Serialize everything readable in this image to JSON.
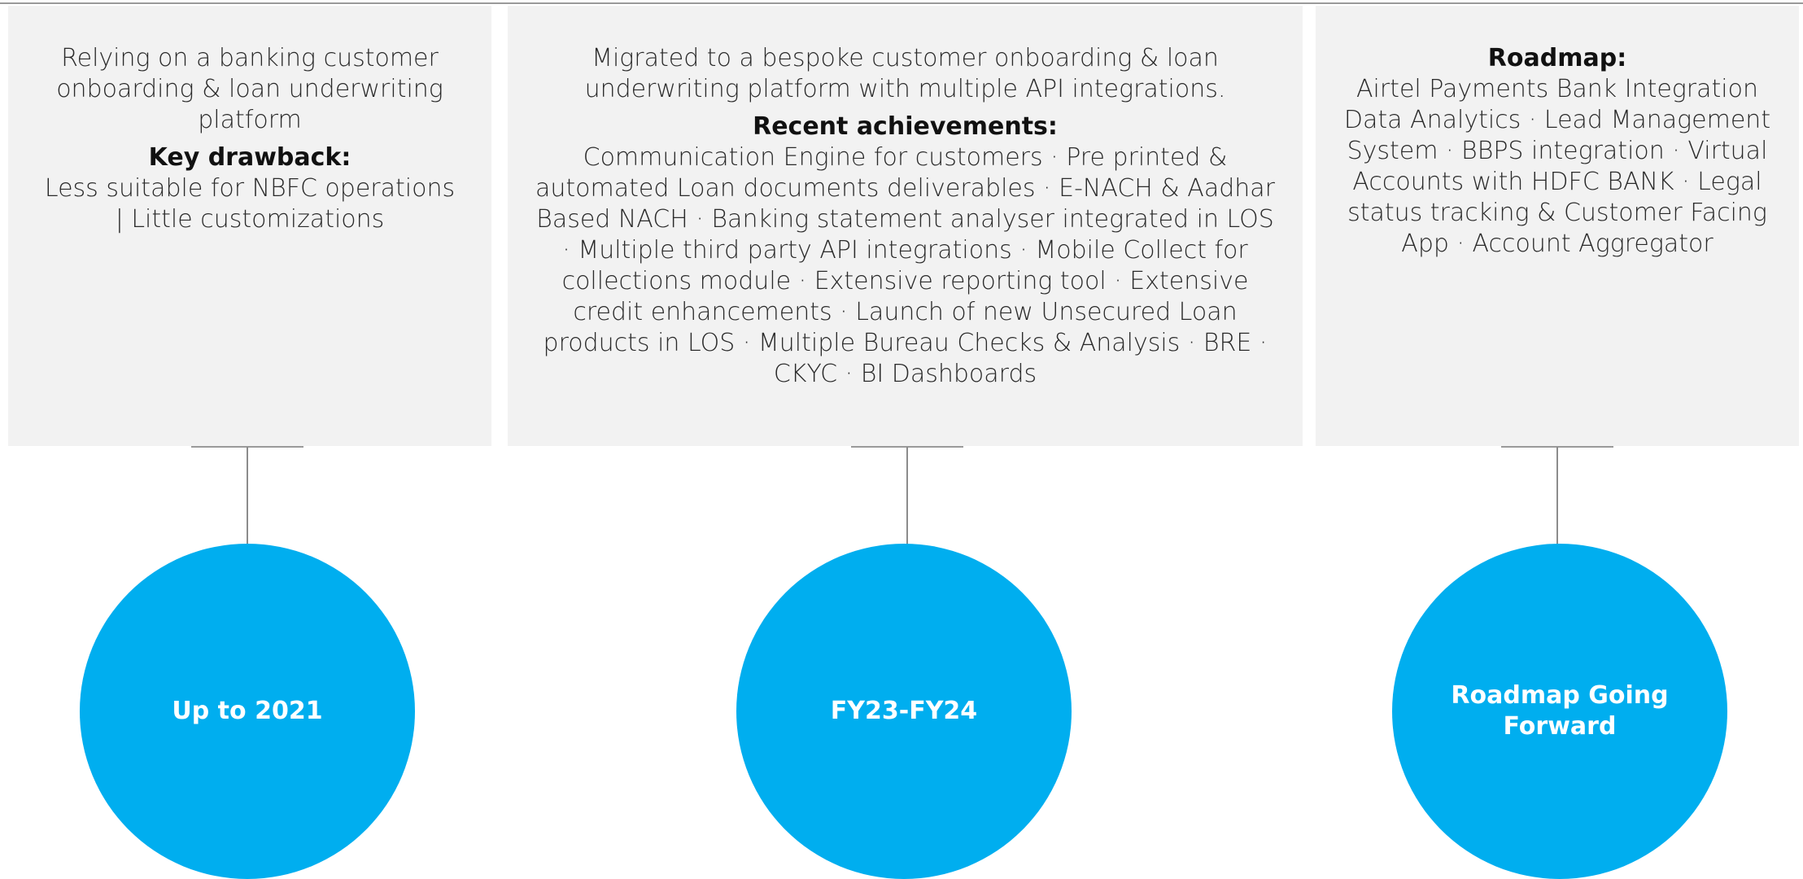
{
  "colors": {
    "panel_bg": "#f2f2f2",
    "circle_fill": "#00aeef",
    "connector": "#9a9a9a"
  },
  "stages": [
    {
      "label": "Up to 2021",
      "intro": "Relying on a banking customer onboarding & loan underwriting platform",
      "heading": "Key drawback:",
      "body": "Less suitable for NBFC operations | Little customizations"
    },
    {
      "label": "FY23-FY24",
      "intro": "Migrated to a bespoke customer onboarding & loan underwriting platform with multiple API integrations.",
      "heading": "Recent achievements:",
      "body": "Communication Engine for customers · Pre printed & automated Loan documents deliverables · E-NACH & Aadhar Based NACH · Banking statement analyser integrated in LOS · Multiple third party API integrations · Mobile Collect for collections module · Extensive reporting tool · Extensive credit enhancements · Launch of new Unsecured Loan products in LOS · Multiple Bureau Checks & Analysis · BRE · CKYC · BI Dashboards"
    },
    {
      "label": "Roadmap Going Forward",
      "heading": "Roadmap:",
      "body": "Airtel Payments Bank Integration Data Analytics · Lead Management System · BBPS integration · Virtual Accounts with HDFC BANK · Legal status tracking & Customer Facing App · Account Aggregator"
    }
  ]
}
